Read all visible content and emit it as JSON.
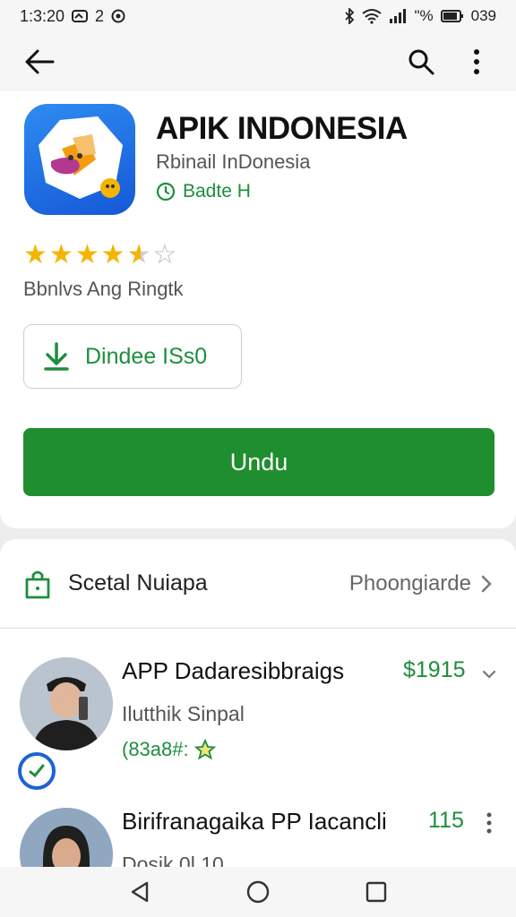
{
  "status_bar": {
    "time": "1:3:20",
    "left_extra": "2",
    "battery_pct": "\"%",
    "right_time": "039"
  },
  "app": {
    "title": "APIK INDONESIA",
    "developer": "Rbinail InDonesia",
    "badge": "Badte H",
    "rating_label": "Bbnlvs Ang Ringtk",
    "stars_filled": 4.5,
    "stars_total": 5,
    "install_outline_label": "Dindee ISs0",
    "primary_button_label": "Undu"
  },
  "section": {
    "title": "Scetal Nuiapa",
    "more_label": "Phoongiarde"
  },
  "items": [
    {
      "title": "APP Dadaresibbraigs",
      "price": "$1915",
      "subtitle": "Ilutthik Sinpal",
      "meta": "(83a8#:"
    },
    {
      "title": "Birifranagaika PP Iacancli",
      "price": "115",
      "subtitle": "Dosik 0l.10"
    }
  ],
  "colors": {
    "accent_green": "#1e8e2e",
    "star_yellow": "#f4b400",
    "app_icon_blue": "#1558d8"
  }
}
